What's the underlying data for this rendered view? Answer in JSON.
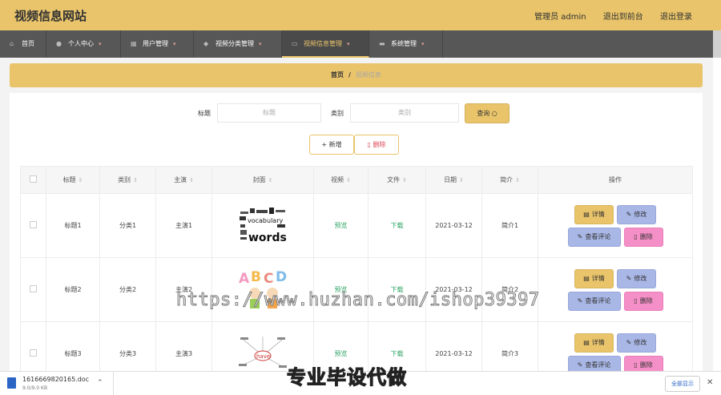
{
  "header": {
    "site_title": "视频信息网站",
    "admin_label": "管理员 admin",
    "back_to_front": "退出到前台",
    "logout": "退出登录"
  },
  "nav": [
    {
      "label": "首页",
      "icon": "home-icon"
    },
    {
      "label": "个人中心",
      "icon": "user-icon"
    },
    {
      "label": "用户管理",
      "icon": "grid-icon"
    },
    {
      "label": "视频分类管理",
      "icon": "location-pin-icon"
    },
    {
      "label": "视频信息管理",
      "icon": "chat-icon",
      "active": true
    },
    {
      "label": "系统管理",
      "icon": "briefcase-icon"
    }
  ],
  "breadcrumb": {
    "home": "首页",
    "separator": "/",
    "current": "视频信息"
  },
  "search": {
    "title_label": "标题",
    "title_placeholder": "标题",
    "category_label": "类别",
    "category_placeholder": "类别",
    "query_button": "查询"
  },
  "actions": {
    "add": "+ 新增",
    "delete": "删除"
  },
  "table": {
    "columns": [
      "标题",
      "类别",
      "主演",
      "封面",
      "视频",
      "文件",
      "日期",
      "简介",
      "操作"
    ],
    "rows": [
      {
        "title": "标题1",
        "category": "分类1",
        "actor": "主演1",
        "video": "预览",
        "file": "下载",
        "date": "2021-03-12",
        "intro": "简介1"
      },
      {
        "title": "标题2",
        "category": "分类2",
        "actor": "主演2",
        "video": "预览",
        "file": "下载",
        "date": "2021-03-12",
        "intro": "简介2"
      },
      {
        "title": "标题3",
        "category": "分类3",
        "actor": "主演3",
        "video": "预览",
        "file": "下载",
        "date": "2021-03-12",
        "intro": "简介3"
      }
    ],
    "op_labels": {
      "detail": "详情",
      "edit": "修改",
      "comment": "查看评论",
      "delete": "删除"
    }
  },
  "watermark": "https://www.huzhan.com/ishop39397",
  "downloads": {
    "file_name": "1616669820165.doc",
    "file_size": "9.0/9.0 KB",
    "caption": "专业毕设代做",
    "show_all": "全部显示"
  },
  "colors": {
    "accent": "#e9c46a",
    "nav_bg": "#575757",
    "edit": "#a9b7e6",
    "delete": "#f58fc7",
    "link": "#2fa564"
  }
}
